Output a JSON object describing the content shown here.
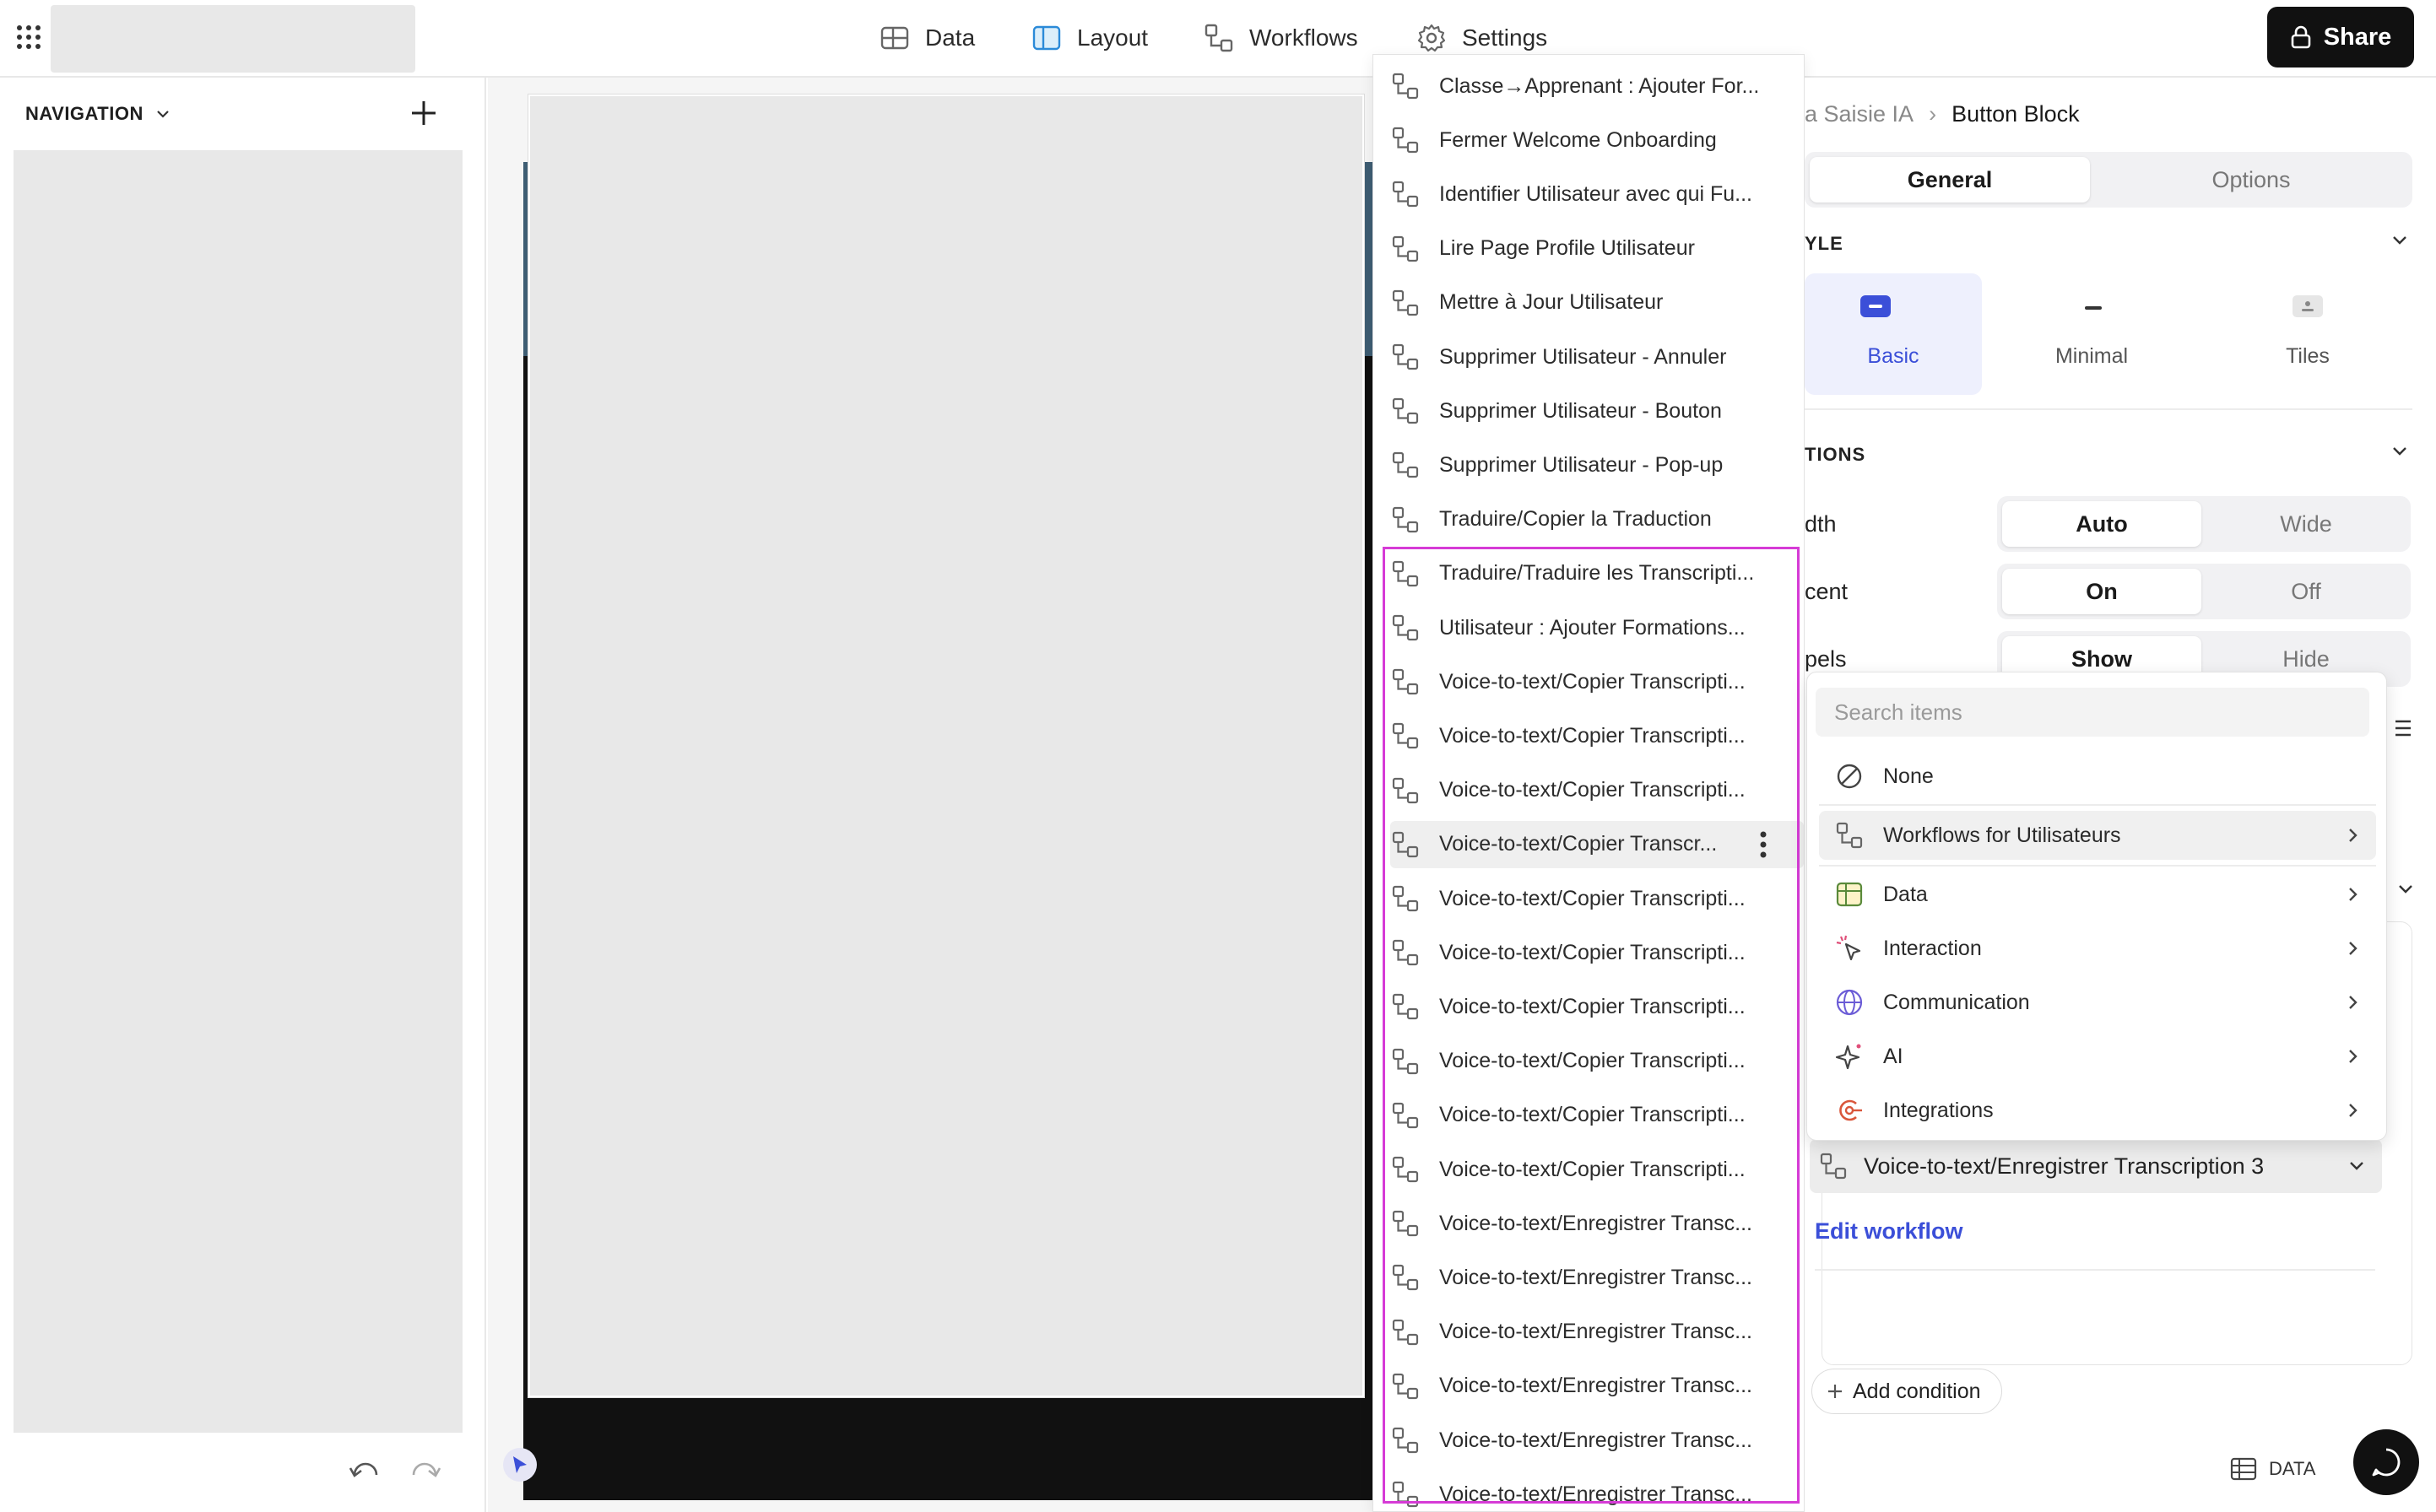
{
  "topbar": {
    "tabs": [
      {
        "label": "Data",
        "icon": "table-icon"
      },
      {
        "label": "Layout",
        "icon": "layout-icon"
      },
      {
        "label": "Workflows",
        "icon": "workflow-icon"
      },
      {
        "label": "Settings",
        "icon": "gear-icon"
      }
    ],
    "active_tab": "Layout",
    "share_label": "Share"
  },
  "left_panel": {
    "title": "NAVIGATION"
  },
  "workflow_list": {
    "items": [
      "Classe→Apprenant : Ajouter For...",
      "Fermer Welcome Onboarding",
      "Identifier Utilisateur avec qui Fu...",
      "Lire Page Profile Utilisateur",
      "Mettre à Jour Utilisateur",
      "Supprimer Utilisateur - Annuler",
      "Supprimer Utilisateur - Bouton",
      "Supprimer Utilisateur - Pop-up",
      "Traduire/Copier la Traduction",
      "Traduire/Traduire les Transcripti...",
      "Utilisateur : Ajouter Formations...",
      "Voice-to-text/Copier Transcripti...",
      "Voice-to-text/Copier Transcripti...",
      "Voice-to-text/Copier Transcripti...",
      "Voice-to-text/Copier Transcr...",
      "Voice-to-text/Copier Transcripti...",
      "Voice-to-text/Copier Transcripti...",
      "Voice-to-text/Copier Transcripti...",
      "Voice-to-text/Copier Transcripti...",
      "Voice-to-text/Copier Transcripti...",
      "Voice-to-text/Copier Transcripti...",
      "Voice-to-text/Enregistrer Transc...",
      "Voice-to-text/Enregistrer Transc...",
      "Voice-to-text/Enregistrer Transc...",
      "Voice-to-text/Enregistrer Transc...",
      "Voice-to-text/Enregistrer Transc...",
      "Voice-to-text/Enregistrer Transc..."
    ],
    "hovered_index": 14,
    "highlight_color": "#d63bd6"
  },
  "right_panel": {
    "breadcrumb_parent": "a Saisie IA",
    "breadcrumb_separator": "›",
    "breadcrumb_current": "Button Block",
    "tabs": [
      "General",
      "Options"
    ],
    "style_section": "YLE",
    "styles": [
      {
        "label": "Basic",
        "icon": "basic-style-icon"
      },
      {
        "label": "Minimal",
        "icon": "minimal-style-icon"
      },
      {
        "label": "Tiles",
        "icon": "tiles-style-icon"
      }
    ],
    "options_section": "TIONS",
    "rows": [
      {
        "label": "dth",
        "options": [
          "Auto",
          "Wide"
        ],
        "selected": "Auto"
      },
      {
        "label": "cent",
        "options": [
          "On",
          "Off"
        ],
        "selected": "On"
      },
      {
        "label": "pels",
        "options": [
          "Show",
          "Hide"
        ],
        "selected": "Show"
      }
    ],
    "selected_action": "Voice-to-text/Enregistrer Transcription 3",
    "edit_workflow": "Edit workflow",
    "add_condition": "Add condition",
    "accent": "#3b4fd8"
  },
  "action_menu": {
    "search_placeholder": "Search items",
    "items": [
      {
        "label": "None",
        "icon": "none-icon",
        "submenu": false
      },
      {
        "label": "Workflows for Utilisateurs",
        "icon": "workflow-icon",
        "submenu": true
      },
      {
        "label": "Data",
        "icon": "table-icon",
        "submenu": true
      },
      {
        "label": "Interaction",
        "icon": "cursor-click-icon",
        "submenu": true
      },
      {
        "label": "Communication",
        "icon": "globe-icon",
        "submenu": true
      },
      {
        "label": "AI",
        "icon": "sparkle-icon",
        "submenu": true
      },
      {
        "label": "Integrations",
        "icon": "integrations-icon",
        "submenu": true
      }
    ],
    "active_index": 1
  },
  "footer": {
    "data_label": "DATA"
  }
}
